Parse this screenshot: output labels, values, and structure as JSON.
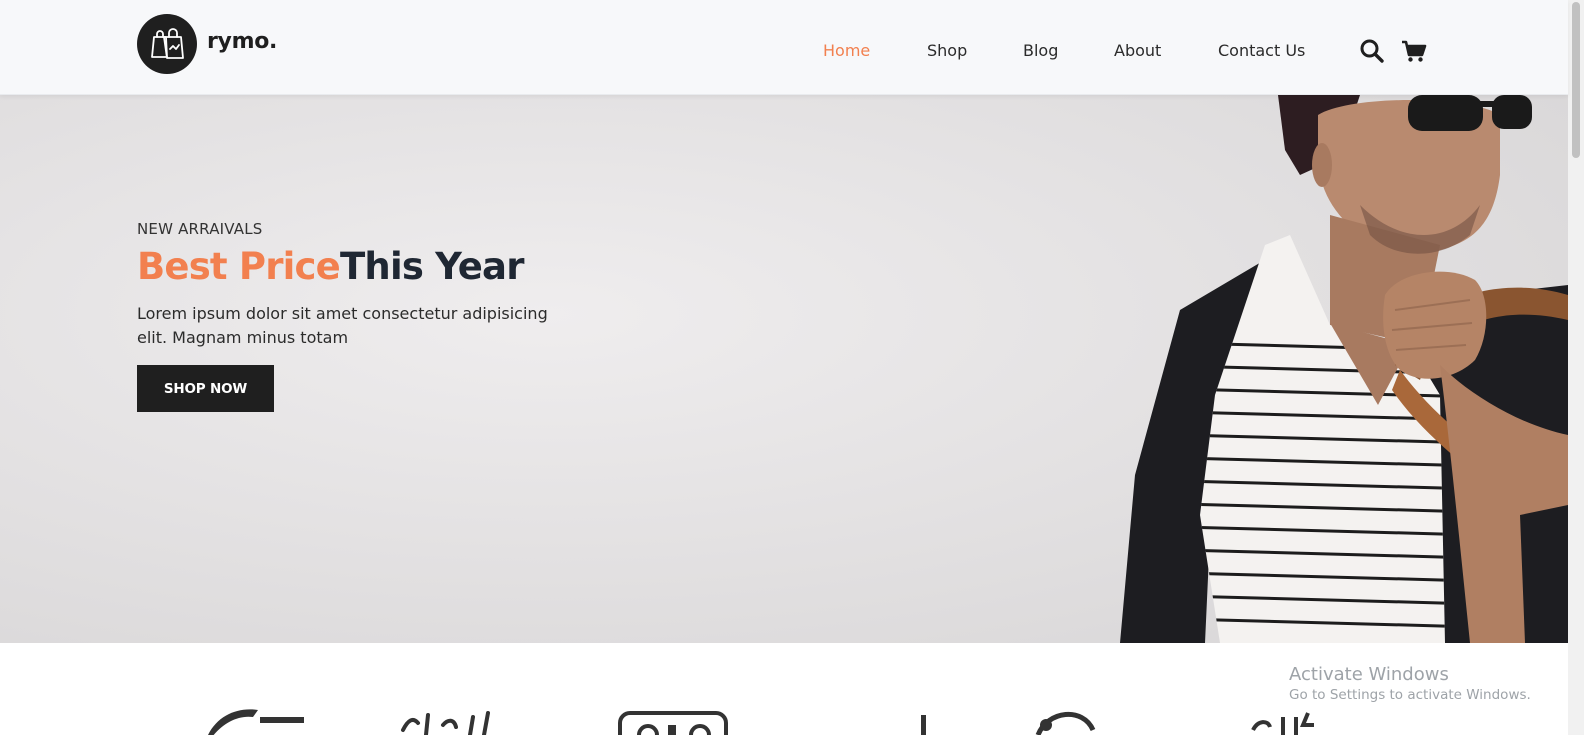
{
  "brand": {
    "name": "rymo."
  },
  "nav": [
    {
      "label": "Home",
      "active": true
    },
    {
      "label": "Shop",
      "active": false
    },
    {
      "label": "Blog",
      "active": false
    },
    {
      "label": "About",
      "active": false
    },
    {
      "label": "Contact Us",
      "active": false
    }
  ],
  "icons": {
    "search": "search-icon",
    "cart": "cart-icon",
    "logo": "shopping-bag-icon"
  },
  "hero": {
    "eyebrow": "NEW ARRAIVALS",
    "headline_accent": "Best Price",
    "headline_rest": "This Year",
    "text": "Lorem ipsum dolor sit amet consectetur adipisicing elit. Magnam minus totam",
    "cta": "SHOP NOW"
  },
  "watermark": {
    "title": "Activate Windows",
    "subtitle": "Go to Settings to activate Windows."
  },
  "colors": {
    "accent": "#f2804f",
    "dark": "#1f1f1f",
    "header_bg": "#f7f8fa"
  }
}
